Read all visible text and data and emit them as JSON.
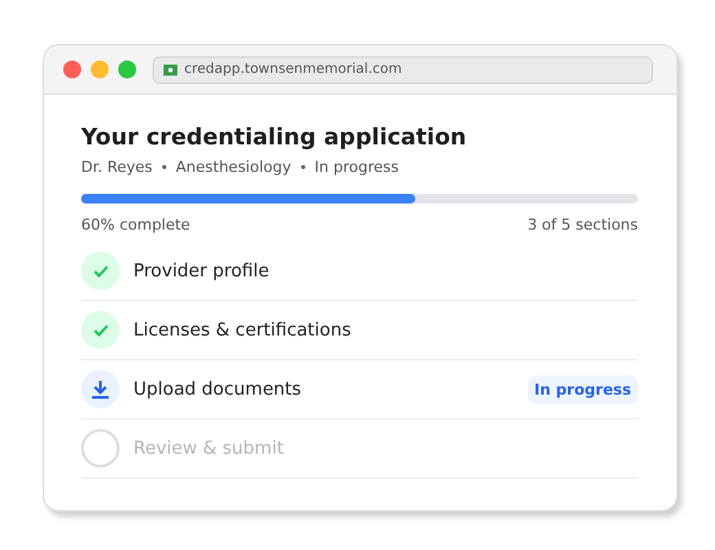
{
  "browser": {
    "url": "credapp.townsenmemorial.com"
  },
  "application": {
    "title": "Your credentialing application",
    "meta": [
      "Dr. Reyes",
      "Anesthesiology",
      "In progress"
    ],
    "progress": {
      "level": 0.6,
      "label": "60% complete",
      "sections": "3 of 5 sections"
    }
  },
  "steps": [
    {
      "label": "Provider profile",
      "kind": "done"
    },
    {
      "label": "Licenses & certifications",
      "kind": "done"
    },
    {
      "label": "Upload documents",
      "kind": "current",
      "badge": "In progress"
    },
    {
      "label": "Review & submit",
      "kind": "pending"
    }
  ]
}
